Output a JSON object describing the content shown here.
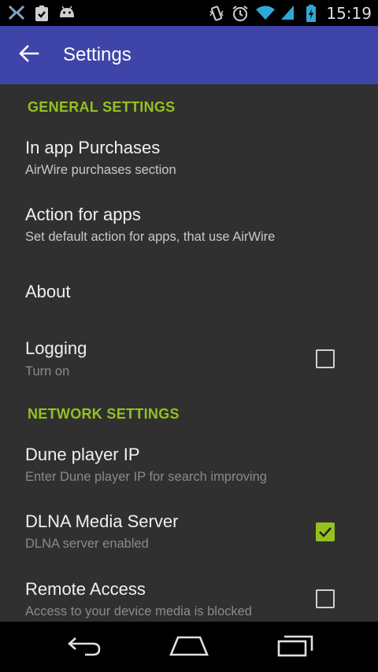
{
  "status_bar": {
    "time": "15:19",
    "left_icons": [
      "x-app-icon",
      "clipboard-check-icon",
      "android-icon"
    ],
    "right_icons": [
      "vibrate-icon",
      "alarm-icon",
      "wifi-icon",
      "signal-icon",
      "battery-charging-icon"
    ]
  },
  "app_bar": {
    "title": "Settings",
    "color": "#3f45a8"
  },
  "accent_color": "#94c11f",
  "sections": [
    {
      "header": "GENERAL SETTINGS",
      "items": [
        {
          "title": "In app Purchases",
          "summary": "AirWire purchases section"
        },
        {
          "title": "Action for apps",
          "summary": "Set default action for apps, that use AirWire"
        },
        {
          "title": "About"
        },
        {
          "title": "Logging",
          "summary": "Turn on",
          "checkbox": false
        }
      ]
    },
    {
      "header": "NETWORK SETTINGS",
      "items": [
        {
          "title": "Dune player IP",
          "summary": "Enter Dune player IP for search improving"
        },
        {
          "title": "DLNA Media Server",
          "summary": "DLNA server enabled",
          "checkbox": true
        },
        {
          "title": "Remote Access",
          "summary": "Access to your device media is blocked",
          "checkbox": false
        }
      ]
    }
  ],
  "nav_bar": {
    "buttons": [
      "back-icon",
      "home-icon",
      "recents-icon"
    ]
  }
}
